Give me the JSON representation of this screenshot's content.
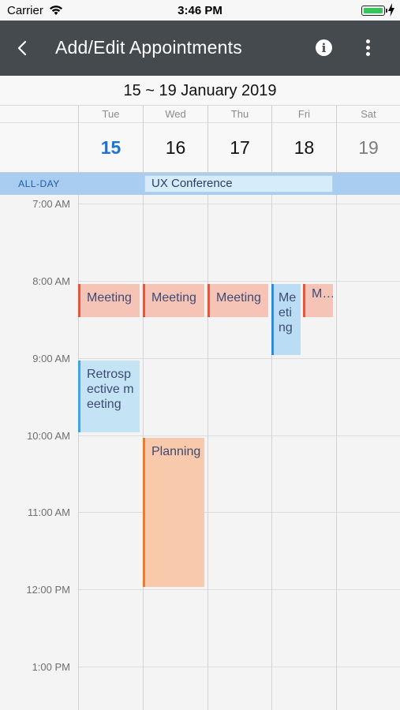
{
  "status": {
    "carrier": "Carrier",
    "time": "3:46 PM"
  },
  "appbar": {
    "title": "Add/Edit Appointments"
  },
  "range": "15 ~ 19 January 2019",
  "days": [
    {
      "name": "Tue",
      "num": "15"
    },
    {
      "name": "Wed",
      "num": "16"
    },
    {
      "name": "Thu",
      "num": "17"
    },
    {
      "name": "Fri",
      "num": "18"
    },
    {
      "name": "Sat",
      "num": "19"
    }
  ],
  "allday": {
    "label": "ALL-DAY",
    "event": "UX Conference"
  },
  "times": [
    "7:00 AM",
    "8:00 AM",
    "9:00 AM",
    "10:00 AM",
    "11:00 AM",
    "12:00 PM",
    "1:00 PM"
  ],
  "events": {
    "tue_meeting": "Meeting",
    "wed_meeting": "Meeting",
    "thu_meeting": "Meeting",
    "fri_meeting": "Meeting",
    "fri_second": "M…",
    "retrospective": "Retrospective meeting",
    "planning": "Planning"
  },
  "colors": {
    "appbar": "#454a4e",
    "today": "#1b73d6",
    "allday_band": "#a9cdf0",
    "meeting_red": "#e9543a",
    "meeting_blue": "#2a8de1",
    "planning_orange": "#ef7a2e"
  }
}
